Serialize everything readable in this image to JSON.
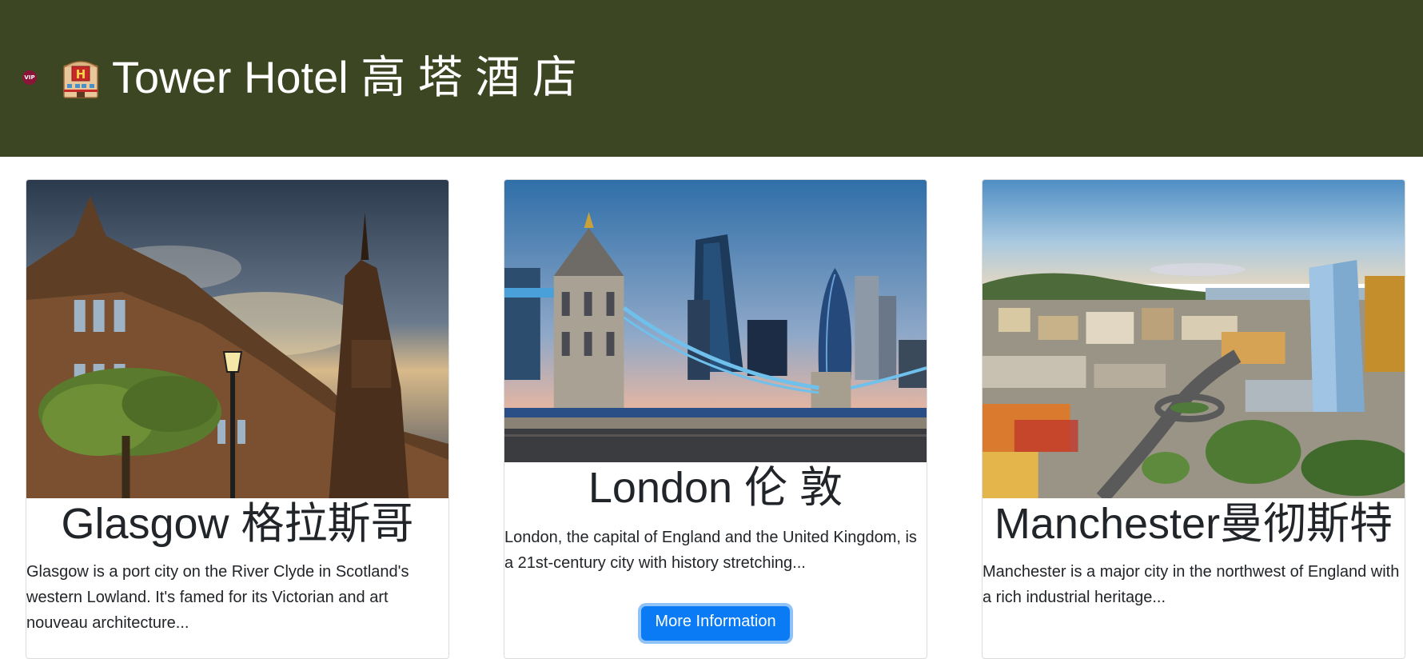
{
  "header": {
    "vip_badge": "VIP",
    "hotel_icon": "hotel-building-icon",
    "title": "Tower Hotel 高 塔 酒 店",
    "background_color": "#3c4622"
  },
  "cards": [
    {
      "title": "Glasgow 格拉斯哥",
      "description": "Glasgow is a port city on the River Clyde in Scotland's western Lowland. It's famed for its Victorian and art nouveau architecture...",
      "image": "glasgow-university-photo"
    },
    {
      "title": "London 伦 敦",
      "description": "London, the capital of England and the United Kingdom, is a 21st-century city with history stretching...",
      "image": "london-tower-bridge-photo",
      "button_label": "More Information"
    },
    {
      "title": "Manchester曼彻斯特",
      "description": "Manchester is a major city in the northwest of England with a rich industrial heritage...",
      "image": "city-aerial-photo"
    }
  ],
  "colors": {
    "button": "#0b7bf5",
    "button_focus_ring": "#8fc2f7"
  }
}
